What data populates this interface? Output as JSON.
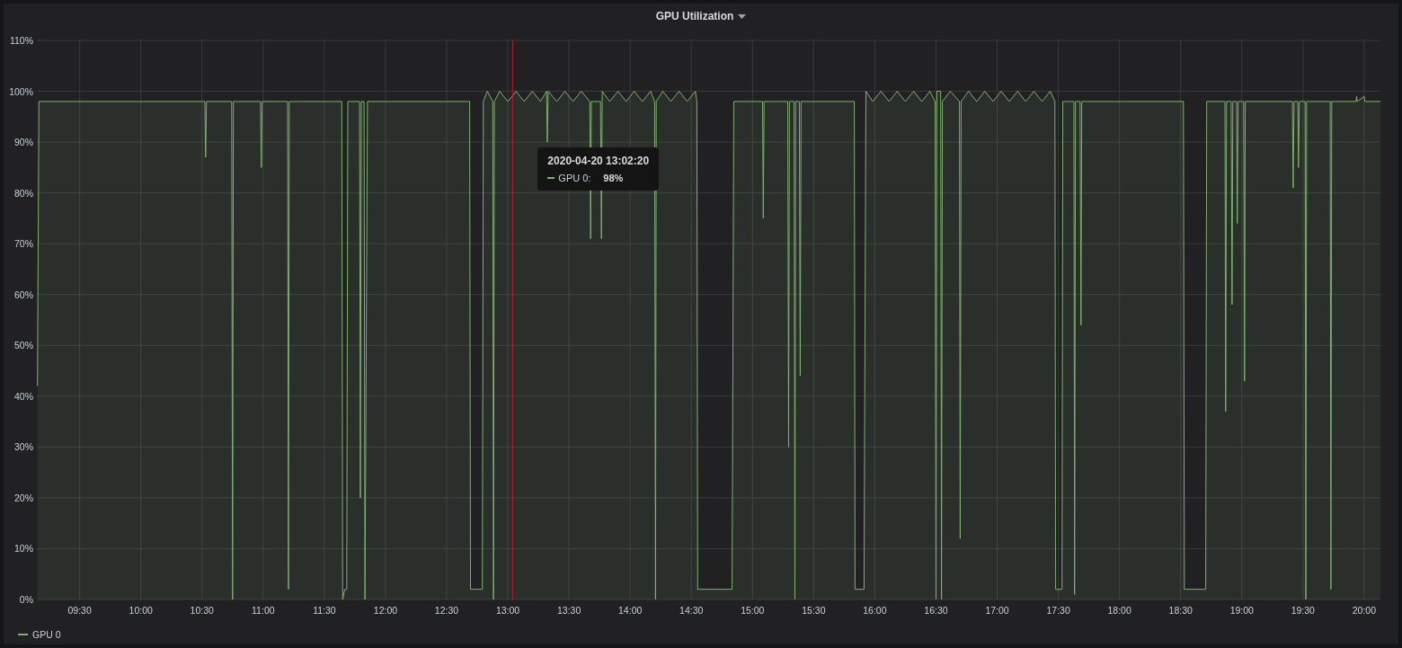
{
  "panel": {
    "title": "GPU Utilization"
  },
  "chart_data": {
    "type": "area",
    "xlim": [
      9.15,
      20.133
    ],
    "ylim": [
      0,
      110
    ],
    "yticks": [
      {
        "value": 0,
        "label": "0%"
      },
      {
        "value": 10,
        "label": "10%"
      },
      {
        "value": 20,
        "label": "20%"
      },
      {
        "value": 30,
        "label": "30%"
      },
      {
        "value": 40,
        "label": "40%"
      },
      {
        "value": 50,
        "label": "50%"
      },
      {
        "value": 60,
        "label": "60%"
      },
      {
        "value": 70,
        "label": "70%"
      },
      {
        "value": 80,
        "label": "80%"
      },
      {
        "value": 90,
        "label": "90%"
      },
      {
        "value": 100,
        "label": "100%"
      },
      {
        "value": 110,
        "label": "110%"
      }
    ],
    "xticks": [
      {
        "value": 9.5,
        "label": "09:30"
      },
      {
        "value": 10,
        "label": "10:00"
      },
      {
        "value": 10.5,
        "label": "10:30"
      },
      {
        "value": 11,
        "label": "11:00"
      },
      {
        "value": 11.5,
        "label": "11:30"
      },
      {
        "value": 12,
        "label": "12:00"
      },
      {
        "value": 12.5,
        "label": "12:30"
      },
      {
        "value": 13,
        "label": "13:00"
      },
      {
        "value": 13.5,
        "label": "13:30"
      },
      {
        "value": 14,
        "label": "14:00"
      },
      {
        "value": 14.5,
        "label": "14:30"
      },
      {
        "value": 15,
        "label": "15:00"
      },
      {
        "value": 15.5,
        "label": "15:30"
      },
      {
        "value": 16,
        "label": "16:00"
      },
      {
        "value": 16.5,
        "label": "16:30"
      },
      {
        "value": 17,
        "label": "17:00"
      },
      {
        "value": 17.5,
        "label": "17:30"
      },
      {
        "value": 18,
        "label": "18:00"
      },
      {
        "value": 18.5,
        "label": "18:30"
      },
      {
        "value": 19,
        "label": "19:00"
      },
      {
        "value": 19.5,
        "label": "19:30"
      },
      {
        "value": 20,
        "label": "20:00"
      }
    ],
    "x": [
      9.155,
      9.167,
      10.523,
      10.53,
      10.537,
      10.743,
      10.75,
      10.757,
      10.978,
      10.985,
      10.992,
      11.2,
      11.207,
      11.213,
      11.643,
      11.65,
      11.667,
      11.683,
      11.692,
      11.788,
      11.795,
      11.802,
      11.825,
      11.832,
      11.853,
      12.688,
      12.695,
      12.792,
      12.8,
      12.833,
      12.877,
      12.883,
      12.89,
      12.933,
      13,
      13.067,
      13.133,
      13.2,
      13.267,
      13.317,
      13.323,
      13.33,
      13.4,
      13.467,
      13.533,
      13.6,
      13.67,
      13.677,
      13.683,
      13.758,
      13.765,
      13.772,
      13.833,
      13.9,
      13.967,
      14.033,
      14.1,
      14.167,
      14.2,
      14.207,
      14.213,
      14.267,
      14.333,
      14.4,
      14.467,
      14.533,
      14.545,
      14.552,
      14.833,
      14.847,
      15.082,
      15.088,
      15.095,
      15.288,
      15.295,
      15.302,
      15.34,
      15.347,
      15.353,
      15.383,
      15.39,
      15.397,
      15.832,
      15.838,
      15.912,
      15.927,
      15.983,
      16.05,
      16.117,
      16.183,
      16.25,
      16.317,
      16.383,
      16.45,
      16.493,
      16.5,
      16.507,
      16.538,
      16.545,
      16.552,
      16.617,
      16.692,
      16.698,
      16.705,
      16.767,
      16.833,
      16.9,
      16.967,
      17.033,
      17.1,
      17.167,
      17.233,
      17.3,
      17.367,
      17.433,
      17.472,
      17.478,
      17.53,
      17.537,
      17.627,
      17.633,
      17.64,
      17.678,
      17.685,
      17.692,
      18.523,
      18.53,
      18.705,
      18.713,
      18.862,
      18.868,
      18.875,
      18.913,
      18.92,
      18.927,
      18.957,
      18.963,
      18.97,
      19.015,
      19.022,
      19.028,
      19.413,
      19.42,
      19.427,
      19.457,
      19.463,
      19.47,
      19.517,
      19.523,
      19.53,
      19.722,
      19.728,
      19.735,
      19.933,
      19.938,
      19.943,
      20,
      20.005,
      20.133
    ],
    "series": [
      {
        "name": "GPU 0",
        "color": "#7eb26d",
        "values": [
          42,
          98,
          98,
          87,
          98,
          98,
          0,
          98,
          98,
          85,
          98,
          98,
          2,
          98,
          98,
          0,
          2,
          2,
          98,
          98,
          20,
          98,
          98,
          0,
          98,
          98,
          2,
          2,
          98,
          100,
          98,
          0,
          98,
          100,
          98,
          100,
          98,
          100,
          98,
          100,
          90,
          100,
          98,
          100,
          98,
          100,
          98,
          71,
          98,
          98,
          71,
          100,
          98,
          100,
          98,
          100,
          98,
          100,
          98,
          0,
          98,
          100,
          98,
          100,
          98,
          100,
          98,
          2,
          2,
          98,
          98,
          75,
          98,
          98,
          30,
          98,
          98,
          0,
          98,
          98,
          44,
          98,
          98,
          2,
          2,
          100,
          98,
          100,
          98,
          100,
          98,
          100,
          98,
          100,
          98,
          0,
          100,
          100,
          0,
          98,
          100,
          98,
          12,
          98,
          100,
          98,
          100,
          98,
          100,
          98,
          100,
          98,
          100,
          98,
          100,
          98,
          2,
          2,
          98,
          98,
          1,
          98,
          98,
          54,
          98,
          98,
          2,
          2,
          98,
          98,
          37,
          98,
          98,
          58,
          98,
          98,
          74,
          98,
          98,
          43,
          98,
          98,
          81,
          98,
          98,
          85,
          98,
          98,
          0,
          98,
          98,
          2,
          98,
          98,
          99,
          98,
          99,
          98,
          98
        ]
      }
    ],
    "ref_lines": [
      {
        "axis": "x",
        "value": 13.039,
        "color": "#c4162a"
      }
    ],
    "grid": true
  },
  "tooltip": {
    "time": "2020-04-20 13:02:20",
    "series": "GPU 0:",
    "value": "98%"
  }
}
